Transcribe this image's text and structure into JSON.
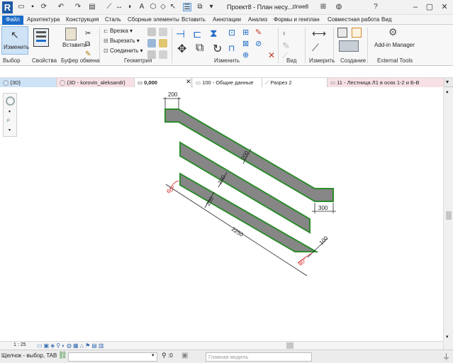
{
  "titlebar": {
    "title": "Проект8 - План несу...",
    "user": "zlrwe8",
    "letter_a": "A",
    "colors": {
      "brand": "#1f5aa6"
    }
  },
  "menu": {
    "tabs": [
      "Файл",
      "Архитектура",
      "Конструкция",
      "Сталь",
      "Сборные элементы",
      "Вставить",
      "Аннотации",
      "Анализ",
      "Формы и генплан",
      "Совместная работа",
      "Вид"
    ]
  },
  "ribbon": {
    "modify_label": "Изменить",
    "paste_label": "Вставить",
    "cut_label": "Врезка",
    "cut_out_label": "Вырезать",
    "join_label": "Соединить",
    "addin_label": "Add-in Manager",
    "panels": [
      "Выбор",
      "Свойства",
      "Буфер обмена",
      "Геометрия",
      "Изменить",
      "Вид",
      "Измерить",
      "Создание",
      "External Tools"
    ]
  },
  "doc_tabs": [
    {
      "label": "{3D}",
      "active": false
    },
    {
      "label": "{3D - korovin_aleksandr}",
      "active": false
    },
    {
      "label": "0,000",
      "active": true
    },
    {
      "label": "100 - Общие данные",
      "active": false
    },
    {
      "label": "Разрез 2",
      "active": false
    },
    {
      "label": "11 - Лестница Л1 в осях 1-2 и Б-В",
      "active": false
    }
  ],
  "drawing": {
    "dims": [
      "200",
      "200",
      "200",
      "200",
      "300",
      "2250",
      "100",
      "60°",
      "60°"
    ]
  },
  "viewbar": {
    "scale": "1 : 25"
  },
  "status": {
    "hint": "Щелчок - выбор, TAB",
    "count": ":0",
    "model": "Главная модель"
  }
}
